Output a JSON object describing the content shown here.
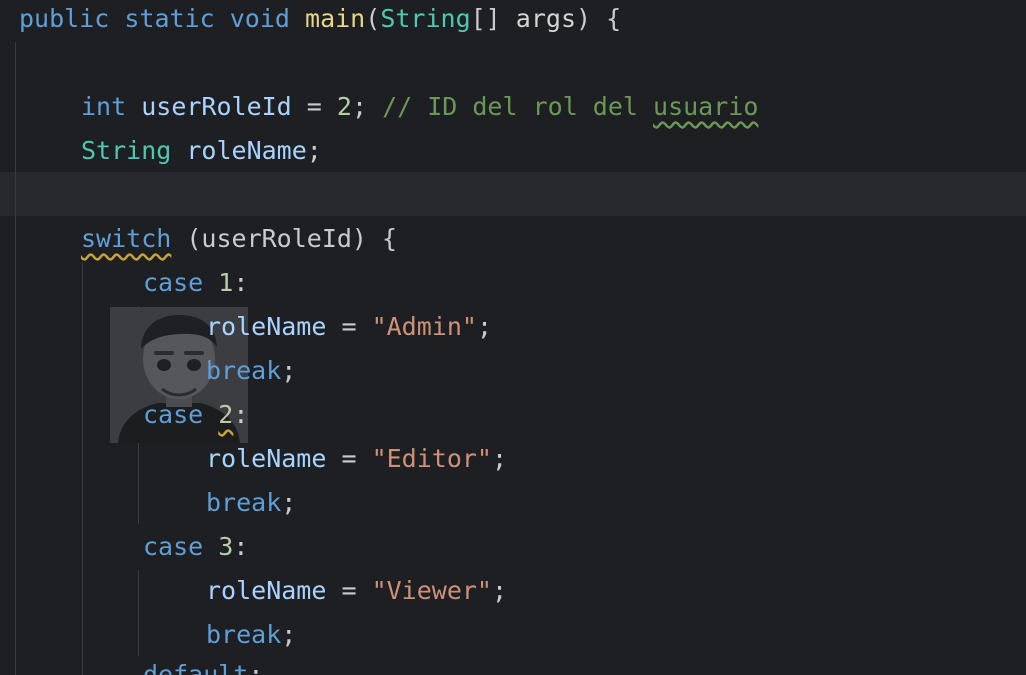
{
  "editor": {
    "colors": {
      "background": "#1e1f22",
      "current_line": "#26282e",
      "keyword": "#5f9fd8",
      "type": "#4ec9b0",
      "string": "#ce9178",
      "comment": "#6a9955",
      "number": "#b5cea8"
    },
    "lines": {
      "l1": {
        "kw_public": "public",
        "kw_static": "static",
        "kw_void": "void",
        "fn_main": "main",
        "open_paren": "(",
        "type_string": "String",
        "brackets": "[]",
        "param_args": "args",
        "close": ") {"
      },
      "l3": {
        "kw_int": "int",
        "var": "userRoleId",
        "eq": " = ",
        "num": "2",
        "semi": ";",
        "comment_prefix": "// ID del rol del ",
        "comment_word": "usuario"
      },
      "l4": {
        "type": "String",
        "var": "roleName",
        "semi": ";"
      },
      "l6": {
        "kw_switch": "switch",
        "rest": " (userRoleId) {"
      },
      "l7": {
        "kw_case": "case",
        "num": "1",
        "colon": ":"
      },
      "l8": {
        "var": "roleName",
        "eq": " = ",
        "str": "\"Admin\"",
        "semi": ";"
      },
      "l9": {
        "kw_break": "break",
        "semi": ";"
      },
      "l10": {
        "kw_case": "case",
        "num": "2",
        "colon": ":"
      },
      "l11": {
        "var": "roleName",
        "eq": " = ",
        "str": "\"Editor\"",
        "semi": ";"
      },
      "l12": {
        "kw_break": "break",
        "semi": ";"
      },
      "l13": {
        "kw_case": "case",
        "num": "3",
        "colon": ":"
      },
      "l14": {
        "var": "roleName",
        "eq": " = ",
        "str": "\"Viewer\"",
        "semi": ";"
      },
      "l15": {
        "kw_break": "break",
        "semi": ";"
      },
      "l16": {
        "kw_default": "default",
        "colon": ":"
      }
    },
    "overlay": {
      "icon": "user-avatar-icon"
    }
  }
}
